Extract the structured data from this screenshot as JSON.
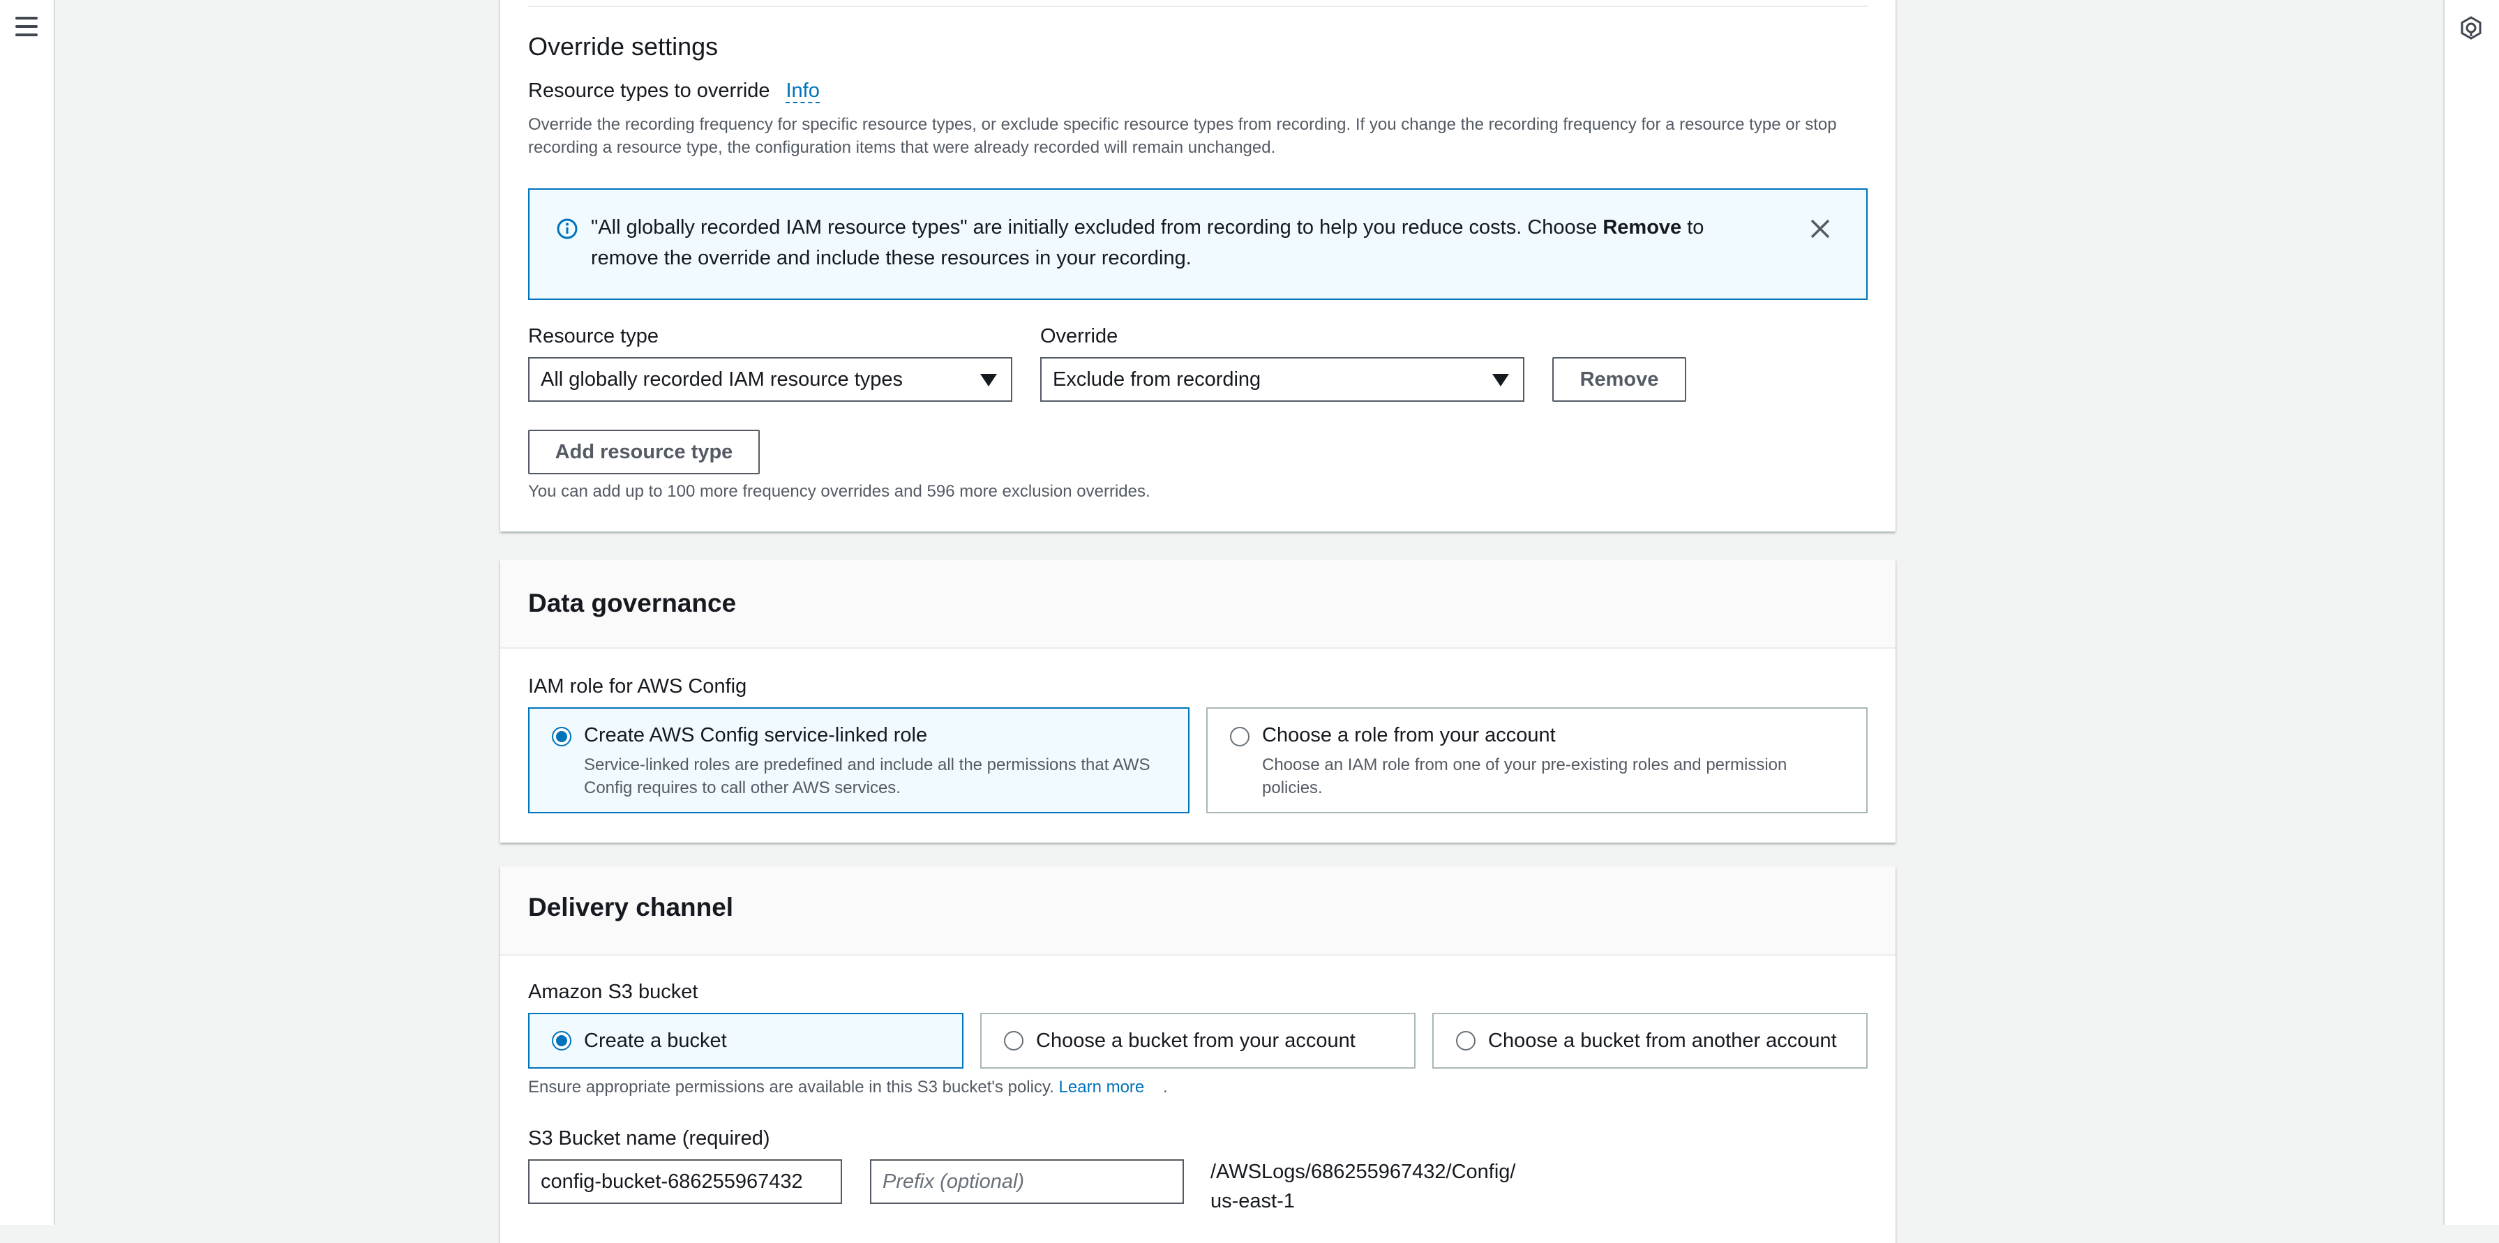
{
  "override": {
    "heading": "Override settings",
    "resource_types_label": "Resource types to override",
    "info_link": "Info",
    "description": "Override the recording frequency for specific resource types, or exclude specific resource types from recording. If you change the recording frequency for a resource type or stop recording a resource type, the configuration items that were already recorded will remain unchanged.",
    "alert": {
      "text_before": "\"All globally recorded IAM resource types\" are initially excluded from recording to help you reduce costs. Choose ",
      "text_bold": "Remove",
      "text_after": " to remove the override and include these resources in your recording."
    },
    "resource_type_label": "Resource type",
    "resource_type_value": "All globally recorded IAM resource types",
    "override_label": "Override",
    "override_value": "Exclude from recording",
    "remove_button": "Remove",
    "add_button": "Add resource type",
    "limit_note": "You can add up to 100 more frequency overrides and 596 more exclusion overrides."
  },
  "data_governance": {
    "heading": "Data governance",
    "iam_label": "IAM role for AWS Config",
    "options": [
      {
        "title": "Create AWS Config service-linked role",
        "description": "Service-linked roles are predefined and include all the permissions that AWS Config requires to call other AWS services.",
        "selected": true
      },
      {
        "title": "Choose a role from your account",
        "description": "Choose an IAM role from one of your pre-existing roles and permission policies.",
        "selected": false
      }
    ]
  },
  "delivery": {
    "heading": "Delivery channel",
    "bucket_label": "Amazon S3 bucket",
    "options": [
      {
        "title": "Create a bucket",
        "selected": true
      },
      {
        "title": "Choose a bucket from your account",
        "selected": false
      },
      {
        "title": "Choose a bucket from another account",
        "selected": false
      }
    ],
    "policy_note": "Ensure appropriate permissions are available in this S3 bucket's policy.",
    "learn_more": "Learn more",
    "period": ".",
    "bucket_name_label": "S3 Bucket name (required)",
    "bucket_name_value": "config-bucket-686255967432",
    "prefix_placeholder": "Prefix (optional)",
    "path_line1": "/AWSLogs/686255967432/Config/",
    "path_line2": "us-east-1"
  },
  "colors": {
    "accent": "#0073bb",
    "alert_bg": "#f1faff",
    "page_bg": "#f2f3f3"
  }
}
